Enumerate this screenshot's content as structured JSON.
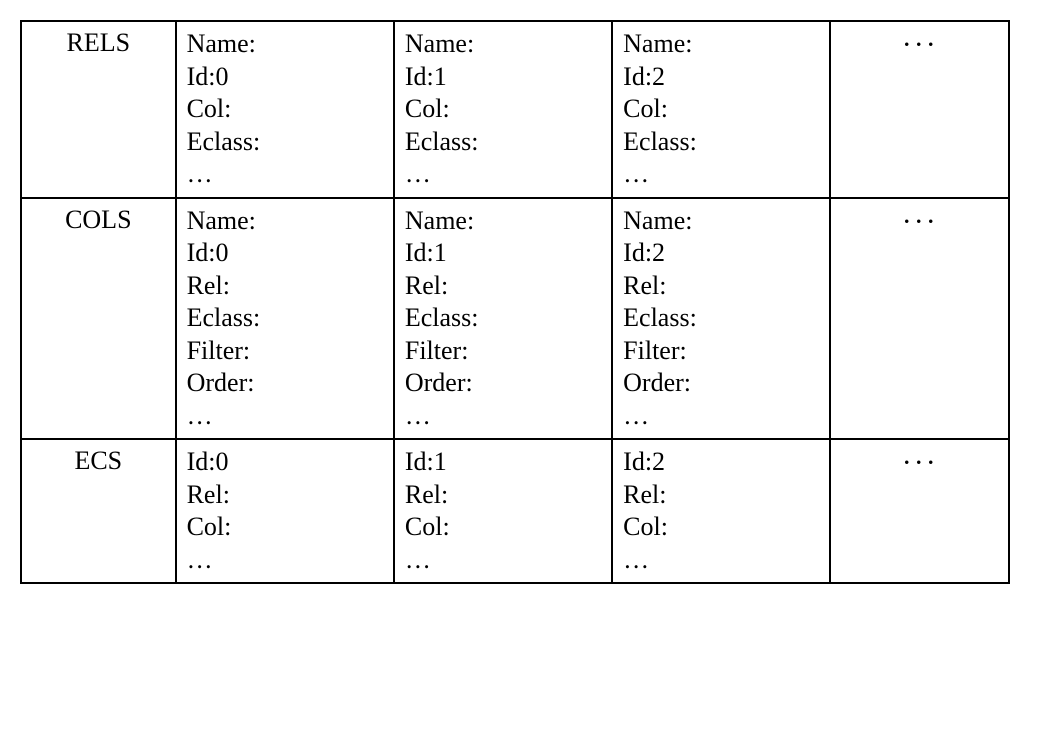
{
  "rows": [
    {
      "label": "RELS",
      "cells": [
        {
          "lines": [
            "Name:",
            "Id:0",
            "Col:",
            "Eclass:",
            "…"
          ]
        },
        {
          "lines": [
            "Name:",
            "Id:1",
            "Col:",
            "Eclass:",
            "…"
          ]
        },
        {
          "lines": [
            "Name:",
            "Id:2",
            "Col:",
            "Eclass:",
            "…"
          ]
        }
      ],
      "more": "···"
    },
    {
      "label": "COLS",
      "cells": [
        {
          "lines": [
            "Name:",
            "Id:0",
            "Rel:",
            "Eclass:",
            "Filter:",
            "Order:",
            "…"
          ]
        },
        {
          "lines": [
            "Name:",
            "Id:1",
            "Rel:",
            "Eclass:",
            "Filter:",
            "Order:",
            "…"
          ]
        },
        {
          "lines": [
            "Name:",
            "Id:2",
            "Rel:",
            "Eclass:",
            "Filter:",
            "Order:",
            "…"
          ]
        }
      ],
      "more": "···"
    },
    {
      "label": "ECS",
      "cells": [
        {
          "lines": [
            "Id:0",
            "Rel:",
            "Col:",
            "…"
          ]
        },
        {
          "lines": [
            "Id:1",
            "Rel:",
            "Col:",
            "…"
          ]
        },
        {
          "lines": [
            "Id:2",
            "Rel:",
            "Col:",
            "…"
          ]
        }
      ],
      "more": "···"
    }
  ]
}
